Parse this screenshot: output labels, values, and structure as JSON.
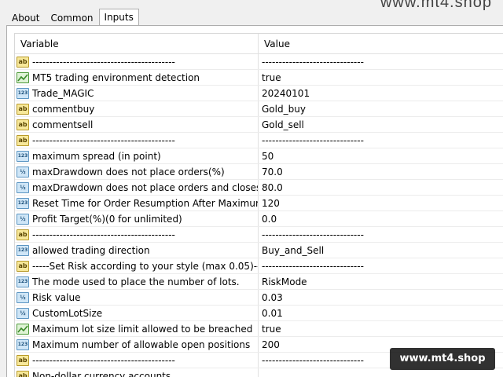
{
  "watermark_top": "www.mt4.shop",
  "watermark_bottom": "www.mt4.shop",
  "tabs": [
    {
      "label": "About"
    },
    {
      "label": "Common"
    },
    {
      "label": "Inputs"
    }
  ],
  "columns": {
    "variable": "Variable",
    "value": "Value"
  },
  "rows": [
    {
      "icon": "ab",
      "variable": "------------------------------------------",
      "value": "------------------------------"
    },
    {
      "icon": "bool",
      "variable": "MT5 trading environment detection",
      "value": "true"
    },
    {
      "icon": "123",
      "variable": "Trade_MAGIC",
      "value": "20240101"
    },
    {
      "icon": "ab",
      "variable": "commentbuy",
      "value": "Gold_buy"
    },
    {
      "icon": "ab",
      "variable": "commentsell",
      "value": "Gold_sell"
    },
    {
      "icon": "ab",
      "variable": "------------------------------------------",
      "value": "------------------------------"
    },
    {
      "icon": "123",
      "variable": "maximum spread (in point)",
      "value": "50"
    },
    {
      "icon": "half",
      "variable": "maxDrawdown does not place orders(%)",
      "value": "70.0"
    },
    {
      "icon": "half",
      "variable": "maxDrawdown does not place orders and closes ...",
      "value": "80.0"
    },
    {
      "icon": "123",
      "variable": "Reset Time for Order Resumption After Maximum...",
      "value": "120"
    },
    {
      "icon": "half",
      "variable": "Profit Target(%)(0 for unlimited)",
      "value": "0.0"
    },
    {
      "icon": "ab",
      "variable": "------------------------------------------",
      "value": "------------------------------"
    },
    {
      "icon": "123",
      "variable": "allowed trading direction",
      "value": "Buy_and_Sell"
    },
    {
      "icon": "ab",
      "variable": "-----Set Risk according to your style (max 0.05)-----",
      "value": "------------------------------"
    },
    {
      "icon": "123",
      "variable": "The mode used to place the number of lots.",
      "value": "RiskMode"
    },
    {
      "icon": "half",
      "variable": "Risk value",
      "value": "0.03"
    },
    {
      "icon": "half",
      "variable": "CustomLotSize",
      "value": "0.01"
    },
    {
      "icon": "bool",
      "variable": "Maximum lot size limit allowed to be breached",
      "value": "true"
    },
    {
      "icon": "123",
      "variable": "Maximum number of allowable open positions",
      "value": "200"
    },
    {
      "icon": "ab",
      "variable": "------------------------------------------",
      "value": "------------------------------"
    },
    {
      "icon": "ab",
      "variable": "Non-dollar currency accounts.",
      "value": ""
    }
  ],
  "icons": {
    "ab": {
      "label": "ab",
      "name": "string-type-icon"
    },
    "123": {
      "label": "123",
      "name": "integer-type-icon"
    },
    "half": {
      "label": "½",
      "name": "double-type-icon"
    },
    "bool": {
      "label": "",
      "name": "bool-type-icon"
    }
  },
  "colors": {
    "string_icon": "#f7e89a",
    "number_icon": "#cfe6f7",
    "bool_icon": "#dff3d6"
  }
}
